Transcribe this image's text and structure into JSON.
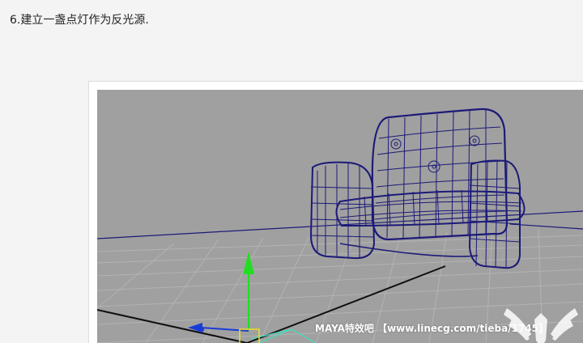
{
  "step": {
    "text": "6.建立一盏点灯作为反光源."
  },
  "viewport": {
    "background_color": "#a0a0a0",
    "wireframe_color": "#1c1a78",
    "grid_color": "#b3b3b3",
    "axis_color": "#101010",
    "manipulator_y_color": "#22dd22",
    "manipulator_x_color": "#1a3cd6",
    "selection_color": "#f0e020",
    "light_color": "#40e0c0"
  },
  "watermark": {
    "text": "MAYA特效吧 【www.linecg.com/tieba/1745】",
    "logo_icon": "wings-logo-icon"
  }
}
